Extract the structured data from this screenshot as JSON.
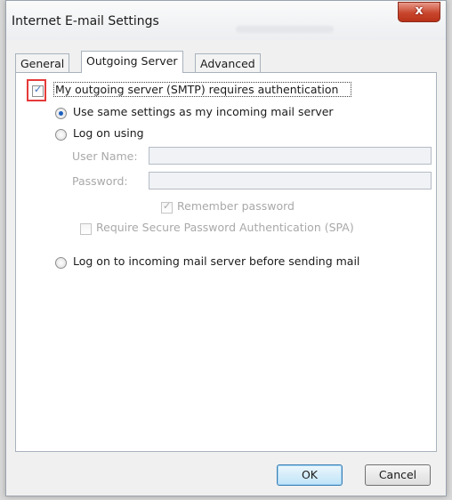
{
  "window": {
    "title": "Internet E-mail Settings",
    "close_glyph": "x"
  },
  "tabs": [
    {
      "label": "General"
    },
    {
      "label": "Outgoing Server"
    },
    {
      "label": "Advanced"
    }
  ],
  "outgoing": {
    "auth_checkbox": {
      "label": "My outgoing server (SMTP) requires authentication",
      "checked": true
    },
    "use_same_settings": {
      "label": "Use same settings as my incoming mail server",
      "selected": true
    },
    "log_on_using": {
      "label": "Log on using",
      "selected": false
    },
    "username": {
      "label": "User Name:",
      "value": ""
    },
    "password": {
      "label": "Password:",
      "value": ""
    },
    "remember_password": {
      "label": "Remember password",
      "checked": true
    },
    "spa": {
      "label": "Require Secure Password Authentication (SPA)",
      "checked": false
    },
    "log_on_incoming": {
      "label": "Log on to incoming mail server before sending mail",
      "selected": false
    }
  },
  "buttons": {
    "ok": "OK",
    "cancel": "Cancel"
  },
  "colors": {
    "highlight": "#e53a3a",
    "accent": "#1c5fbf",
    "close": "#c8462d"
  }
}
